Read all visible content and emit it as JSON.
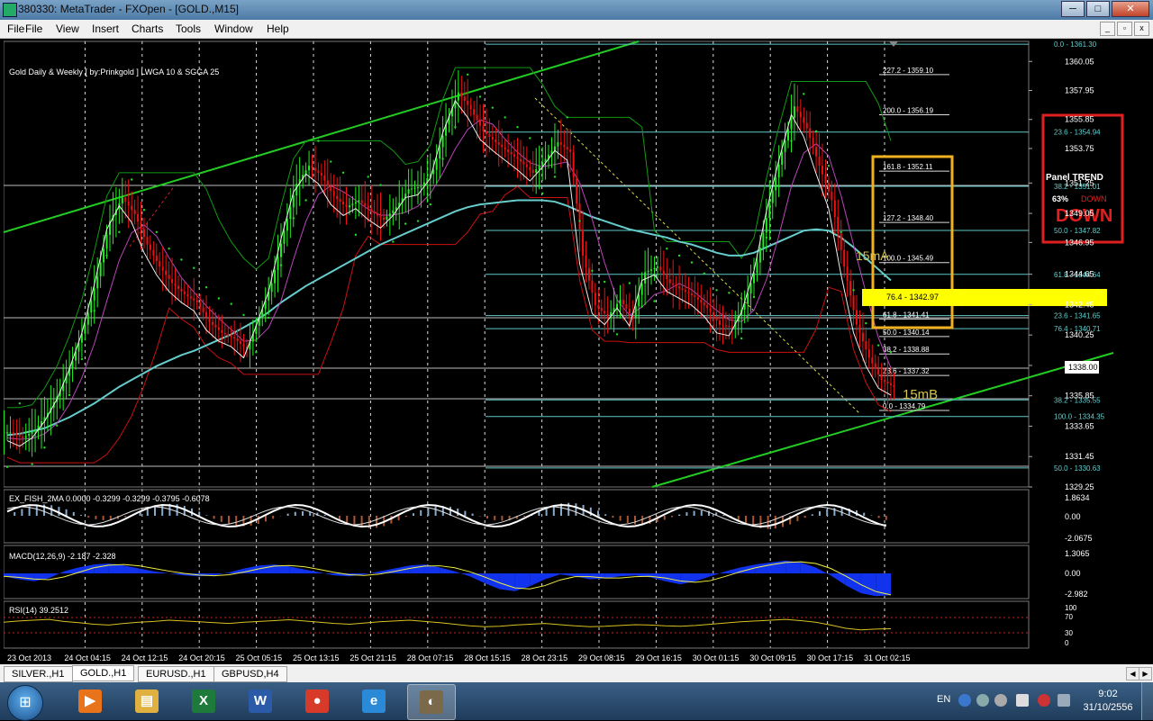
{
  "window": {
    "title": "380330: MetaTrader - FXOpen - [GOLD.,M15]",
    "controls": {
      "minimize": "─",
      "maximize": "□",
      "close": "✕"
    }
  },
  "menu": {
    "items": [
      "File",
      "View",
      "Insert",
      "Charts",
      "Tools",
      "Window",
      "Help"
    ],
    "mdi": {
      "minimize": "_",
      "restore": "▫",
      "close": "x"
    }
  },
  "chart_data": {
    "type": "line",
    "title": "Gold Daily & Weekly [ by:Prinkgold ] LWGA 10  &  SGGA 25",
    "symbol": "GOLD.",
    "timeframe": "M15",
    "current_price": "1338.00",
    "y_ticks": [
      "1360.05",
      "1357.95",
      "1355.85",
      "1353.75",
      "1351.25",
      "1349.05",
      "1346.95",
      "1344.65",
      "1342.45",
      "1340.25",
      "1338.05",
      "1335.85",
      "1333.65",
      "1331.45",
      "1329.25"
    ],
    "x_ticks": [
      "23 Oct 2013",
      "24 Oct 04:15",
      "24 Oct 12:15",
      "24 Oct 20:15",
      "25 Oct 05:15",
      "25 Oct 13:15",
      "25 Oct 21:15",
      "28 Oct 07:15",
      "28 Oct 15:15",
      "28 Oct 23:15",
      "29 Oct 08:15",
      "29 Oct 16:15",
      "30 Oct 01:15",
      "30 Oct 09:15",
      "30 Oct 17:15",
      "31 Oct 02:15"
    ],
    "fib_levels_right": [
      {
        "label": "0.0 - 1361.30",
        "price": 1361.3
      },
      {
        "label": "23.6 - 1354.94",
        "price": 1354.94
      },
      {
        "label": "38.2 - 1351.01",
        "price": 1351.01
      },
      {
        "label": "50.0 - 1347.82",
        "price": 1347.82
      },
      {
        "label": "61.8 - 1344.64",
        "price": 1344.64
      },
      {
        "label": "23.6 - 1341.65",
        "price": 1341.65
      },
      {
        "label": "76.4 - 1340.71",
        "price": 1340.71
      },
      {
        "label": "38.2 - 1335.55",
        "price": 1335.55
      },
      {
        "label": "100.0 - 1334.35",
        "price": 1334.35
      },
      {
        "label": "50.0 - 1330.63",
        "price": 1330.63
      }
    ],
    "fib_levels_mid": [
      {
        "label": "227.2 - 1359.10",
        "price": 1359.1
      },
      {
        "label": "200.0 - 1356.19",
        "price": 1356.19
      },
      {
        "label": "161.8 - 1352.11",
        "price": 1352.11
      },
      {
        "label": "127.2 - 1348.40",
        "price": 1348.4
      },
      {
        "label": "100.0 - 1345.49",
        "price": 1345.49
      },
      {
        "label": "76.4 - 1342.97",
        "price": 1342.97
      },
      {
        "label": "61.8 - 1341.41",
        "price": 1341.41
      },
      {
        "label": "50.0 - 1340.14",
        "price": 1340.14
      },
      {
        "label": "38.2 - 1338.88",
        "price": 1338.88
      },
      {
        "label": "23.6 - 1337.32",
        "price": 1337.32
      },
      {
        "label": "0.0 - 1334.79",
        "price": 1334.79
      }
    ],
    "annotations": {
      "label_15mA": "15mA",
      "label_15mB": "15mB"
    },
    "panel": {
      "title": "Panel  TREND",
      "percent": "63%",
      "direction_small": "DOWN",
      "direction_big": "DOWN"
    },
    "price_series": [
      1333.2,
      1332.8,
      1333.4,
      1334.6,
      1336.2,
      1338.4,
      1341.0,
      1344.5,
      1348.5,
      1350.2,
      1349.0,
      1346.8,
      1345.2,
      1344.0,
      1343.2,
      1342.6,
      1341.2,
      1340.4,
      1340.0,
      1339.2,
      1341.5,
      1344.0,
      1347.8,
      1351.2,
      1352.5,
      1351.8,
      1350.3,
      1349.5,
      1350.0,
      1349.2,
      1348.6,
      1349.5,
      1350.8,
      1351.0,
      1352.2,
      1355.5,
      1357.8,
      1356.6,
      1355.0,
      1354.2,
      1353.5,
      1352.8,
      1352.0,
      1353.0,
      1354.2,
      1353.5,
      1346.0,
      1342.4,
      1341.6,
      1342.8,
      1341.5,
      1344.8,
      1345.2,
      1344.0,
      1343.5,
      1343.0,
      1342.2,
      1341.0,
      1340.8,
      1342.5,
      1345.5,
      1349.8,
      1353.5,
      1356.8,
      1355.2,
      1352.5,
      1350.0,
      1345.2,
      1341.0,
      1338.6,
      1337.0,
      1336.5
    ],
    "sma_series": [
      1333.0,
      1333.1,
      1333.3,
      1333.5,
      1333.9,
      1334.3,
      1334.8,
      1335.3,
      1335.9,
      1336.5,
      1337.0,
      1337.5,
      1338.0,
      1338.4,
      1338.8,
      1339.1,
      1339.5,
      1339.9,
      1340.3,
      1340.8,
      1341.3,
      1341.9,
      1342.6,
      1343.2,
      1343.8,
      1344.3,
      1344.8,
      1345.3,
      1345.8,
      1346.3,
      1346.8,
      1347.2,
      1347.6,
      1348.0,
      1348.4,
      1348.8,
      1349.2,
      1349.5,
      1349.7,
      1349.8,
      1349.9,
      1350.0,
      1350.0,
      1350.0,
      1349.9,
      1349.6,
      1349.2,
      1348.8,
      1348.5,
      1348.2,
      1347.9,
      1347.7,
      1347.5,
      1347.3,
      1347.0,
      1346.8,
      1346.5,
      1346.2,
      1346.0,
      1346.0,
      1346.2,
      1346.6,
      1347.0,
      1347.4,
      1347.8,
      1347.9,
      1347.8,
      1347.3,
      1346.6,
      1345.8,
      1345.0,
      1344.2
    ],
    "indicators": {
      "fish": {
        "label": "EX_FISH_2MA 0.0000 -0.3299 -0.3299 -0.3795 -0.6078",
        "ticks": [
          "1.8634",
          "0.00",
          "-2.0675"
        ]
      },
      "macd": {
        "label": "MACD(12,26,9) -2.187 -2.328",
        "ticks": [
          "1.3065",
          "0.00",
          "-2.982"
        ],
        "values": [
          -0.3,
          -0.6,
          -0.8,
          -0.5,
          0.2,
          0.6,
          0.9,
          1.0,
          0.8,
          0.5,
          0.2,
          0.0,
          -0.2,
          -0.3,
          -0.2,
          0.1,
          0.5,
          0.8,
          0.9,
          0.7,
          0.4,
          0.1,
          -0.2,
          -0.3,
          -0.1,
          0.2,
          0.5,
          0.8,
          0.9,
          0.6,
          0.2,
          -0.3,
          -1.0,
          -1.6,
          -1.8,
          -1.3,
          -0.6,
          -0.1,
          -0.3,
          -0.6,
          -0.5,
          -0.3,
          -0.2,
          -0.4,
          -0.8,
          -1.1,
          -0.8,
          -0.3,
          0.2,
          0.6,
          0.9,
          1.1,
          1.3,
          1.1,
          0.6,
          -0.2,
          -1.2,
          -2.0,
          -2.3,
          -2.2
        ]
      },
      "rsi": {
        "label": "RSI(14) 39.2512",
        "ticks": [
          "100",
          "70",
          "30",
          "0"
        ],
        "values": [
          55,
          58,
          60,
          62,
          57,
          54,
          50,
          48,
          52,
          55,
          57,
          60,
          58,
          56,
          54,
          52,
          55,
          57,
          59,
          61,
          58,
          55,
          52,
          50,
          53,
          56,
          58,
          60,
          57,
          54,
          50,
          46,
          44,
          45,
          48,
          50,
          52,
          49,
          46,
          44,
          45,
          47,
          49,
          48,
          46,
          45,
          47,
          50,
          53,
          56,
          58,
          60,
          62,
          59,
          55,
          48,
          40,
          36,
          38,
          39
        ]
      }
    }
  },
  "tabs": {
    "items": [
      {
        "label": "SILVER.,H1",
        "active": false
      },
      {
        "label": "GOLD.,H1",
        "active": true
      },
      {
        "label": "EURUSD.,H1",
        "active": false
      },
      {
        "label": "GBPUSD,H4",
        "active": false
      }
    ]
  },
  "taskbar": {
    "apps": [
      {
        "name": "media-player",
        "glyph": "▶",
        "color": "#e8731a"
      },
      {
        "name": "file-explorer",
        "glyph": "▤",
        "color": "#e0b040"
      },
      {
        "name": "excel",
        "glyph": "X",
        "color": "#1d7a3a"
      },
      {
        "name": "word",
        "glyph": "W",
        "color": "#2a5aa8"
      },
      {
        "name": "chrome",
        "glyph": "●",
        "color": "#d83a2a"
      },
      {
        "name": "internet-explorer",
        "glyph": "e",
        "color": "#2a8ad8"
      },
      {
        "name": "metatrader",
        "glyph": "◐",
        "color": "#7a6a4a"
      }
    ],
    "tray": {
      "lang": "EN",
      "time": "9:02",
      "date": "31/10/2556"
    }
  }
}
